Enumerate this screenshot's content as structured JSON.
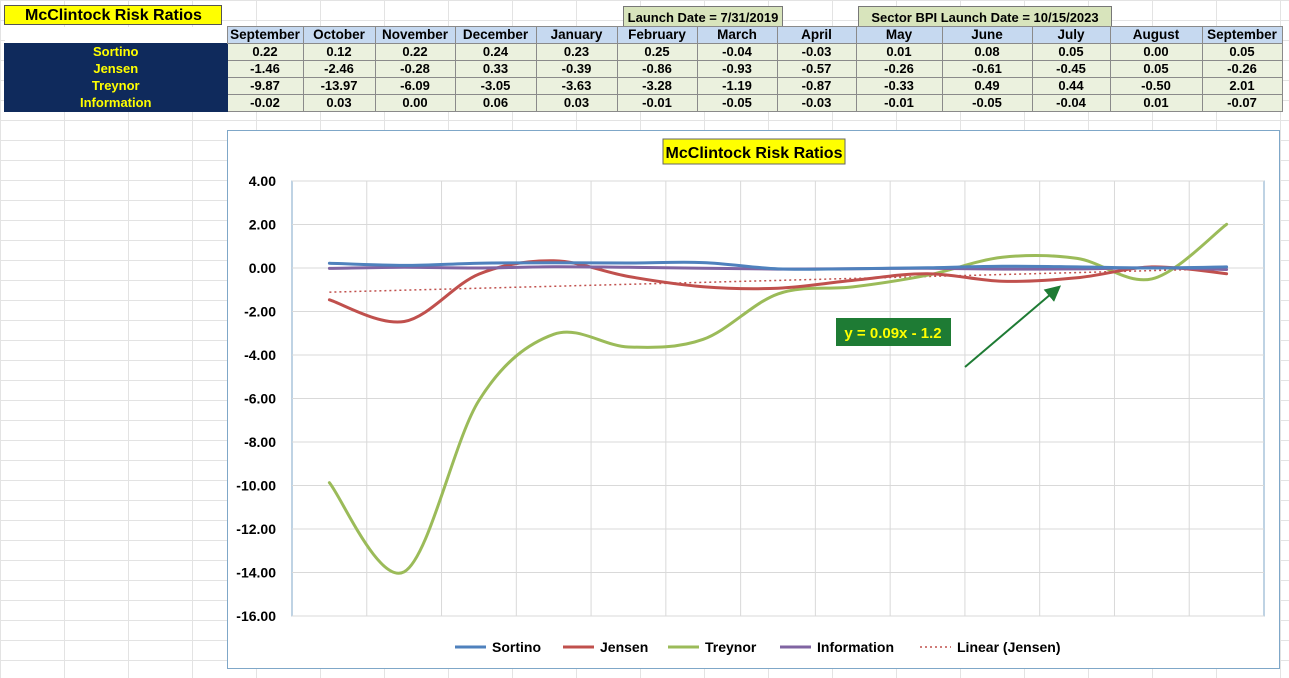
{
  "sheet": {
    "title": "McClintock Risk Ratios",
    "launch_date": "Launch Date = 7/31/2019",
    "sector_launch_date": "Sector BPI Launch Date = 10/15/2023"
  },
  "table": {
    "months": [
      "September",
      "October",
      "November",
      "December",
      "January",
      "February",
      "March",
      "April",
      "May",
      "June",
      "July",
      "August",
      "September"
    ],
    "rows": [
      {
        "label": "Sortino",
        "values": [
          "0.22",
          "0.12",
          "0.22",
          "0.24",
          "0.23",
          "0.25",
          "-0.04",
          "-0.03",
          "0.01",
          "0.08",
          "0.05",
          "0.00",
          "0.05"
        ]
      },
      {
        "label": "Jensen",
        "values": [
          "-1.46",
          "-2.46",
          "-0.28",
          "0.33",
          "-0.39",
          "-0.86",
          "-0.93",
          "-0.57",
          "-0.26",
          "-0.61",
          "-0.45",
          "0.05",
          "-0.26"
        ]
      },
      {
        "label": "Treynor",
        "values": [
          "-9.87",
          "-13.97",
          "-6.09",
          "-3.05",
          "-3.63",
          "-3.28",
          "-1.19",
          "-0.87",
          "-0.33",
          "0.49",
          "0.44",
          "-0.50",
          "2.01"
        ]
      },
      {
        "label": "Information",
        "values": [
          "-0.02",
          "0.03",
          "0.00",
          "0.06",
          "0.03",
          "-0.01",
          "-0.05",
          "-0.03",
          "-0.01",
          "-0.05",
          "-0.04",
          "0.01",
          "-0.07"
        ]
      }
    ]
  },
  "chart_data": {
    "type": "line",
    "title": "McClintock Risk Ratios",
    "categories": [
      "September",
      "October",
      "November",
      "December",
      "January",
      "February",
      "March",
      "April",
      "May",
      "June",
      "July",
      "August",
      "September"
    ],
    "ylim": [
      -16,
      4
    ],
    "yticks": [
      "4.00",
      "2.00",
      "0.00",
      "-2.00",
      "-4.00",
      "-6.00",
      "-8.00",
      "-10.00",
      "-12.00",
      "-14.00",
      "-16.00"
    ],
    "grid": true,
    "legend_position": "bottom",
    "series": [
      {
        "name": "Sortino",
        "color": "#4f81bd",
        "values": [
          0.22,
          0.12,
          0.22,
          0.24,
          0.23,
          0.25,
          -0.04,
          -0.03,
          0.01,
          0.08,
          0.05,
          0.0,
          0.05
        ]
      },
      {
        "name": "Jensen",
        "color": "#c0504d",
        "values": [
          -1.46,
          -2.46,
          -0.28,
          0.33,
          -0.39,
          -0.86,
          -0.93,
          -0.57,
          -0.26,
          -0.61,
          -0.45,
          0.05,
          -0.26
        ]
      },
      {
        "name": "Treynor",
        "color": "#9bbb59",
        "values": [
          -9.87,
          -13.97,
          -6.09,
          -3.05,
          -3.63,
          -3.28,
          -1.19,
          -0.87,
          -0.33,
          0.49,
          0.44,
          -0.5,
          2.01
        ]
      },
      {
        "name": "Information",
        "color": "#8064a2",
        "values": [
          -0.02,
          0.03,
          0.0,
          0.06,
          0.03,
          -0.01,
          -0.05,
          -0.03,
          -0.01,
          -0.05,
          -0.04,
          0.01,
          -0.07
        ]
      }
    ],
    "trendline": {
      "name": "Linear (Jensen)",
      "color": "#c0504d",
      "slope": 0.09,
      "intercept": -1.2
    },
    "annotation": {
      "text": "y = 0.09x - 1.2",
      "background": "#1e7b34",
      "color": "#ffff00",
      "arrow_color": "#1e7b34"
    }
  }
}
